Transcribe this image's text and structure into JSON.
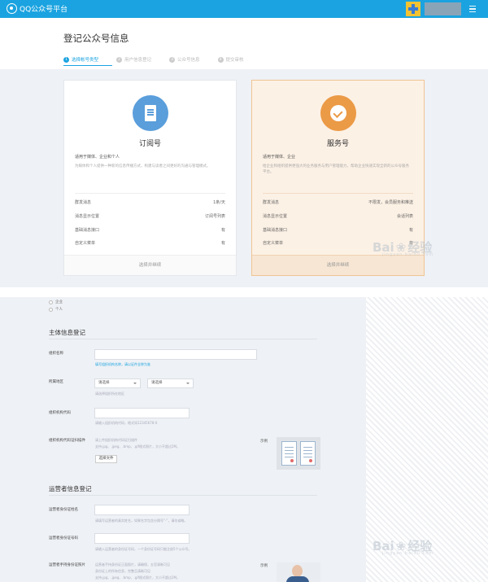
{
  "app": {
    "logo_text": "QQ公众号平台"
  },
  "page": {
    "title": "登记公众号信息"
  },
  "steps": [
    {
      "num": "1",
      "label": "选择帐号类型"
    },
    {
      "num": "2",
      "label": "用户信息登记"
    },
    {
      "num": "3",
      "label": "公众号信息"
    },
    {
      "num": "4",
      "label": "提交审核"
    }
  ],
  "cards": {
    "subscription": {
      "name": "订阅号",
      "suitable": "适用于媒体、企业和个人",
      "desc": "为媒体和个人提供一种新的信息传播方式，构建与读者之间更好的沟通与管理模式。",
      "features": [
        {
          "label": "群发消息",
          "value": "1条/天"
        },
        {
          "label": "消息显示位置",
          "value": "订阅号列表"
        },
        {
          "label": "基础消息接口",
          "value": "有"
        },
        {
          "label": "自定义菜单",
          "value": "有"
        }
      ],
      "button": "选择并继续"
    },
    "service": {
      "name": "服务号",
      "suitable": "适用于媒体、企业",
      "desc": "给企业和组织提供更强大的业务服务与用户管理能力，帮助企业快速实现全新的公众号服务平台。",
      "features": [
        {
          "label": "群发消息",
          "value": "不限发，会员服务和推送"
        },
        {
          "label": "消息显示位置",
          "value": "会话列表"
        },
        {
          "label": "基础消息接口",
          "value": "有"
        },
        {
          "label": "自定义菜单",
          "value": "有"
        }
      ],
      "button": "选择并继续"
    }
  },
  "form": {
    "subject_types": [
      "企业",
      "个人"
    ],
    "section1_title": "主体信息登记",
    "section2_title": "运营者信息登记",
    "fields": {
      "org_name": {
        "label": "组织名称",
        "hint": "填写组织机构名称，请以证件全称为准"
      },
      "region": {
        "label": "所属地区",
        "province": "请选择",
        "city": "请选择",
        "hint": "请选择组织所在地区"
      },
      "org_code": {
        "label": "组织机构代码",
        "hint": "请输入组织机构代码，格式如12345678-X"
      },
      "org_cert": {
        "label": "组织机构代码证扫描件",
        "hint1": "请上传组织机构代码证扫描件",
        "hint2": "支持.jpg、.jpeg、.bmp、.gif格式照片，大小不超过2M。",
        "upload": "选择文件",
        "example": "示例"
      },
      "operator_name": {
        "label": "运营者身份证姓名",
        "hint": "请填写运营者的真实姓名，如果名字包含分隔号“·”，请勿省略。"
      },
      "operator_id": {
        "label": "运营者身份证号码",
        "hint": "请输入运营者的身份证号码，一个身份证号码只能注册5个公众号。"
      },
      "operator_photo": {
        "label": "运营者手持身份证照片",
        "hint1": "运营者手持身份证正面照片，请确保，五官清晰可见",
        "hint2": "身份证上的所有信息，完整且清晰可见",
        "hint3": "支持.jpg、.jpeg、.bmp、.gif格式照片，大小不超过2M。",
        "example": "示例"
      }
    }
  },
  "watermark": {
    "text": "Bai",
    "text2": "经验",
    "sub": "jingyan.baidu.com"
  },
  "colors": {
    "topbar": "#1aa3e0",
    "service_accent": "#eb9a46",
    "subscription_accent": "#5a9edb"
  }
}
